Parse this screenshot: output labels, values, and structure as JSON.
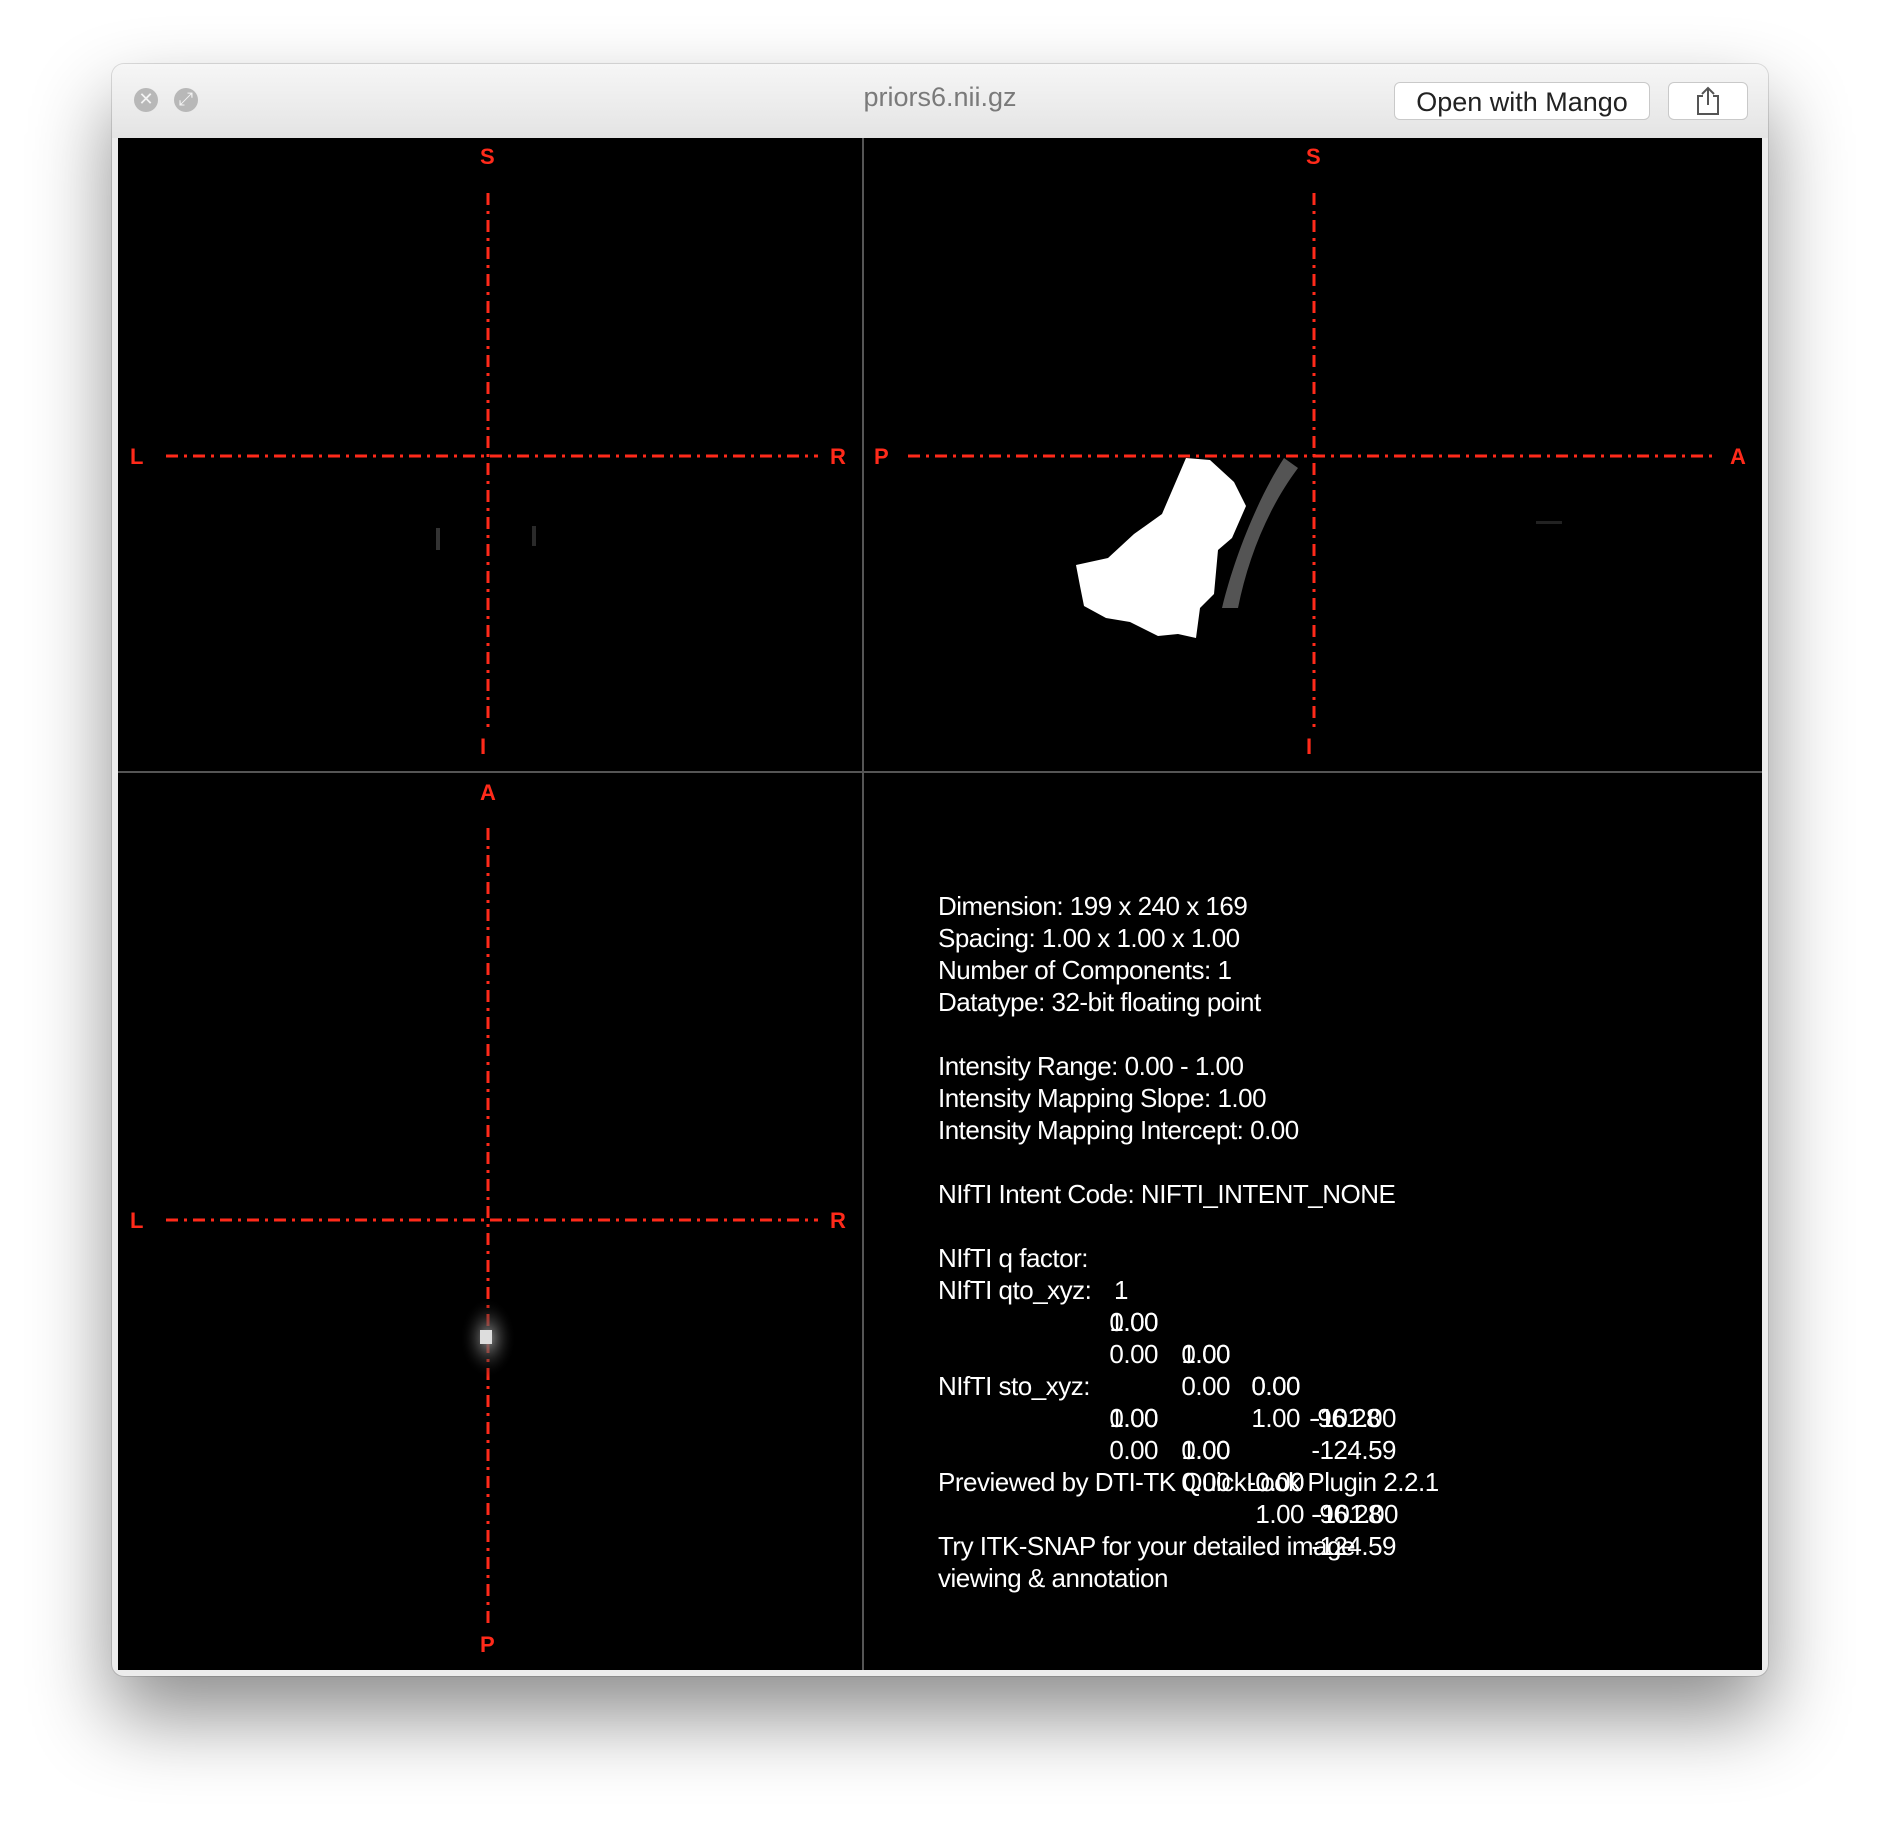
{
  "window": {
    "title": "priors6.nii.gz",
    "open_button": "Open with Mango"
  },
  "views": {
    "coronal": {
      "top": "S",
      "bottom": "I",
      "left": "L",
      "right": "R"
    },
    "sagittal": {
      "top": "S",
      "bottom": "I",
      "left": "P",
      "right": "A"
    },
    "axial": {
      "top": "A",
      "bottom": "P",
      "left": "L",
      "right": "R"
    }
  },
  "info": {
    "dimension": "Dimension: 199 x 240 x 169",
    "spacing": "Spacing: 1.00 x 1.00 x 1.00",
    "components": "Number of Components: 1",
    "datatype": "Datatype: 32-bit floating point",
    "range": "Intensity Range: 0.00 - 1.00",
    "slope": "Intensity Mapping Slope: 1.00",
    "intercept": "Intensity Mapping Intercept: 0.00",
    "intent": "NIfTI Intent Code: NIFTI_INTENT_NONE",
    "qfactor_label": "NIfTI q factor:",
    "qfactor_value": "1",
    "qto_label": "NIfTI qto_xyz:",
    "qto": [
      [
        "1.00",
        "0.00",
        "0.00",
        "-101.00"
      ],
      [
        "0.00",
        "1.00",
        "0.00",
        "-96.28"
      ],
      [
        "0.00",
        "0.00",
        "1.00",
        "-124.59"
      ]
    ],
    "sto_label": "NIfTI sto_xyz:",
    "sto": [
      [
        "1.00",
        "0.00",
        "-0.00",
        "-101.00"
      ],
      [
        "0.00",
        "1.00",
        "-0.00",
        "-96.28"
      ],
      [
        "0.00",
        "0.00",
        "1.00",
        "-124.59"
      ]
    ],
    "previewed": "Previewed by DTI-TK QuickLook Plugin 2.2.1",
    "try_line1": "Try ITK-SNAP for your detailed image",
    "try_line2": "viewing & annotation"
  },
  "colors": {
    "crosshair": "#ff2a1a",
    "background": "#000000"
  }
}
